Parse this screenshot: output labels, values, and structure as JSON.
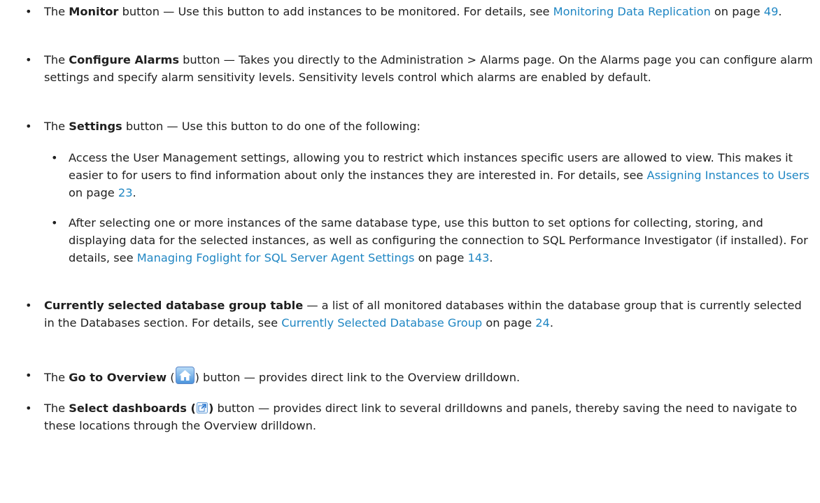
{
  "items": [
    {
      "id": "monitor",
      "pre": "The ",
      "bold": "Monitor",
      "post": " button — Use this button to add instances to be monitored. For details, see ",
      "link": "Monitoring Data Replication",
      "on": " on page ",
      "page": "49",
      "end": "."
    },
    {
      "id": "configure-alarms",
      "pre": "The ",
      "bold": "Configure Alarms",
      "post": " button — Takes you directly to the Administration > Alarms page. On the Alarms page you can configure alarm settings and specify alarm sensitivity levels. Sensitivity levels control which alarms are enabled by default."
    },
    {
      "id": "settings",
      "pre": "The ",
      "bold": "Settings",
      "post": " button — Use this button to do one of the following:"
    },
    {
      "id": "settings-sub-1",
      "text": "Access the User Management settings, allowing you to restrict which instances specific users are allowed to view. This makes it easier to for users to find information about only the instances they are interested in. For details, see ",
      "link": "Assigning Instances to Users",
      "on": " on page ",
      "page": "23",
      "end": "."
    },
    {
      "id": "settings-sub-2",
      "text": "After selecting one or more instances of the same database type, use this button to set options for collecting, storing, and displaying data for the selected instances, as well as configuring the connection to SQL Performance Investigator (if installed). For details, see ",
      "link": "Managing Foglight for SQL Server Agent Settings",
      "on": " on page ",
      "page": "143",
      "end": "."
    },
    {
      "id": "current-group",
      "bold": "Currently selected database group table",
      "post": " — a list of all monitored databases within the database group that is currently selected in the Databases section. For details, see ",
      "link": "Currently Selected Database Group",
      "on": " on page ",
      "page": "24",
      "end": "."
    },
    {
      "id": "go-overview",
      "pre": "The ",
      "bold": "Go to Overview",
      "open": " (",
      "close": ") button — provides direct link to the Overview drilldown."
    },
    {
      "id": "select-dashboards",
      "pre": "The ",
      "bold": "Select dashboards (",
      "close": ")",
      "post": " button — provides direct link to several drilldowns and panels, thereby saving the need to navigate to these locations through the Overview drilldown."
    }
  ],
  "bullet_char": "•",
  "icons": {
    "home": "home-icon",
    "dashboards": "select-dashboards-icon"
  },
  "colors": {
    "link": "#1f86c3",
    "text": "#1f1f1f"
  }
}
